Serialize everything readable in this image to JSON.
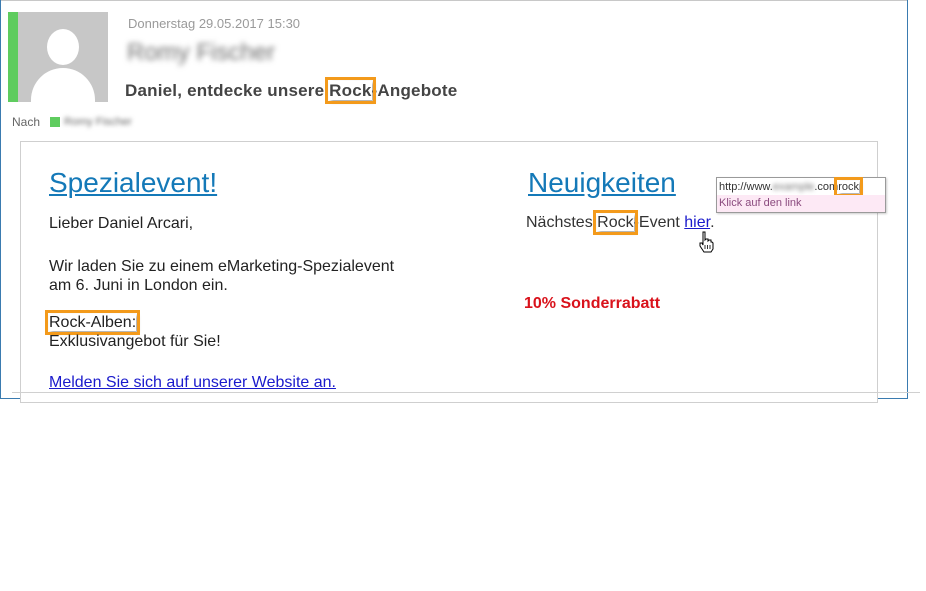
{
  "email": {
    "date": "Donnerstag 29.05.2017 15:30",
    "sender": "Romy Fischer",
    "subject_before": "Daniel, entdecke unsere ",
    "subject_highlight": "Rock",
    "subject_after": "-Angebote",
    "to_label": "Nach",
    "to_name": "Romy Fischer"
  },
  "body": {
    "left_title": "Spezialevent!",
    "greeting": "Lieber Daniel Arcari,",
    "invite_line1": "Wir laden Sie zu einem eMarketing-Spezialevent",
    "invite_line2": "am 6. Juni in London ein.",
    "rock_albums": "Rock-Alben:",
    "exclusive": "Exklusivangebot für Sie!",
    "signup_link": "Melden Sie sich auf unserer Website an.",
    "right_title": "Neuigkeiten",
    "next_before": "Nächstes ",
    "next_highlight": "Rock",
    "next_after": "-Event ",
    "next_link": "hier",
    "next_end": ".",
    "discount": "10% Sonderrabatt"
  },
  "tooltip": {
    "url_prefix": "http://www.",
    "url_blurred": "example",
    "url_suffix": ".com",
    "url_highlight": "rock",
    "hint": "Klick auf den link"
  },
  "colors": {
    "accent_green": "#5fcc5f",
    "highlight_orange": "#f39a1b",
    "title_blue": "#1479b8",
    "link_blue": "#1a1acc",
    "discount_red": "#d9121b"
  }
}
